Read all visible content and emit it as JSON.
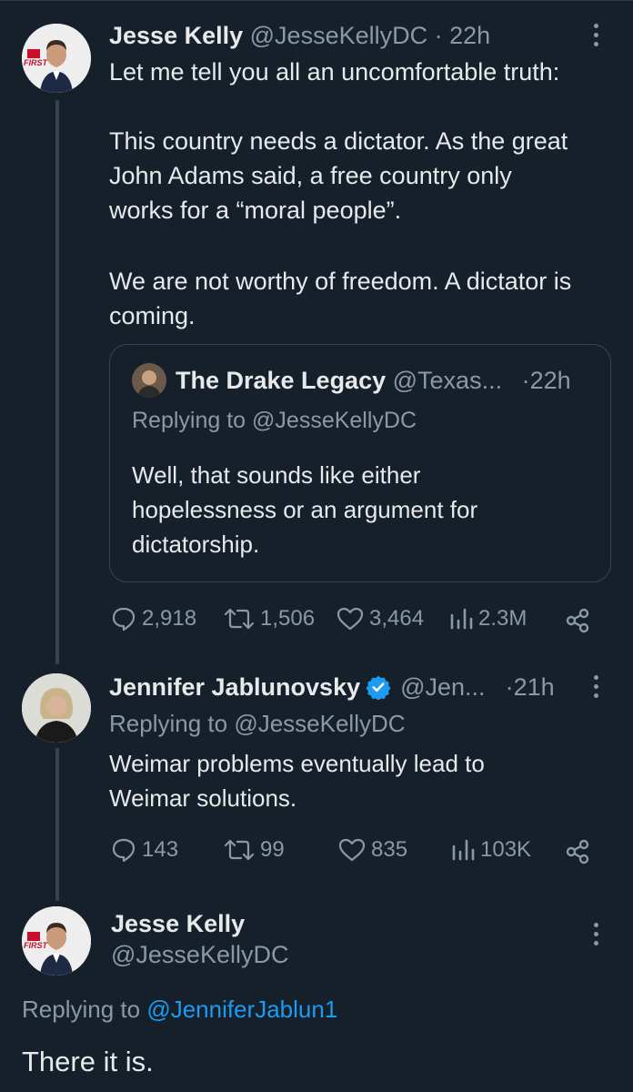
{
  "tweet1": {
    "name": "Jesse Kelly",
    "handle": "@JesseKellyDC",
    "time": "22h",
    "line1": "Let me tell you all an uncomfortable truth:",
    "para2": "This country needs a dictator. As the great John Adams said, a free country only works for a “moral people”.",
    "para3": "We are not worthy of freedom. A dictator is coming.",
    "avatar_logo_text": "FIRST"
  },
  "quote": {
    "name": "The Drake Legacy",
    "handle": "@Texas...",
    "time": "22h",
    "replying_prefix": "Replying to",
    "replying_to": "@JesseKellyDC",
    "body": "Well, that sounds like either hopelessness or an argument for dictatorship."
  },
  "tweet1_actions": {
    "replies": "2,918",
    "retweets": "1,506",
    "likes": "3,464",
    "views": "2.3M"
  },
  "tweet2": {
    "name": "Jennifer Jablunovsky",
    "handle": "@Jen...",
    "time": "21h",
    "replying_prefix": "Replying to",
    "replying_to": "@JesseKellyDC",
    "body": "Weimar problems eventually lead to Weimar solutions.",
    "verified": true
  },
  "tweet2_actions": {
    "replies": "143",
    "retweets": "99",
    "likes": "835",
    "views": "103K"
  },
  "tweet3": {
    "name": "Jesse Kelly",
    "handle": "@JesseKellyDC",
    "replying_prefix": "Replying to",
    "replying_to": "@JenniferJablun1",
    "body": "There it is."
  },
  "colors": {
    "background": "#15202b",
    "text": "#e7e9ea",
    "muted": "#8b98a5",
    "link": "#1d9bf0",
    "border": "#38444d",
    "verified": "#1d9bf0"
  },
  "icons": [
    "more-icon",
    "reply-icon",
    "retweet-icon",
    "like-icon",
    "views-icon",
    "share-icon",
    "verified-badge-icon"
  ]
}
